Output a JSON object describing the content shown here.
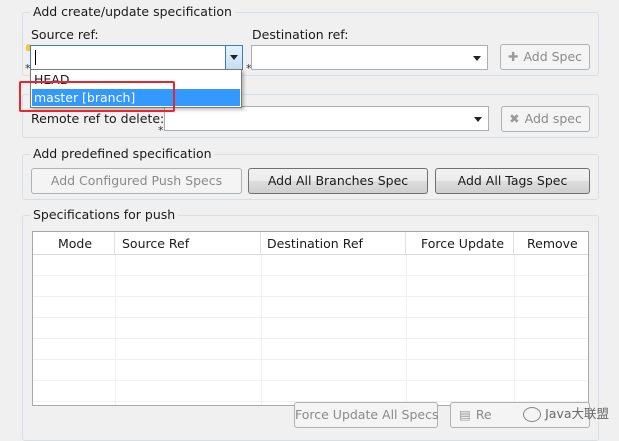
{
  "add_spec_group": {
    "title": "Add create/update specification",
    "source_label": "Source ref:",
    "source_value": "",
    "destination_label": "Destination ref:",
    "destination_value": "",
    "required_marker": "*",
    "add_spec_button": "Add Spec"
  },
  "source_dropdown": {
    "options": [
      "HEAD",
      "master [branch]"
    ],
    "selected": "master [branch]"
  },
  "delete_group": {
    "remote_ref_label": "Remote ref to delete:",
    "remote_ref_value": "",
    "required_marker": "*",
    "add_spec_button": "Add spec"
  },
  "predefined_group": {
    "title": "Add predefined specification",
    "configured_button": "Add Configured Push Specs",
    "all_branches_button": "Add All Branches Spec",
    "all_tags_button": "Add All Tags Spec"
  },
  "specs_group": {
    "title": "Specifications for push",
    "columns": [
      "Mode",
      "Source Ref",
      "Destination Ref",
      "Force Update",
      "Remove"
    ],
    "rows": [],
    "force_update_all_button": "Force Update All Specs",
    "remove_all_button": "Re"
  },
  "watermark": {
    "text": "Java大联盟"
  },
  "colors": {
    "highlight": "#e8262c",
    "selection": "#3399ff"
  }
}
